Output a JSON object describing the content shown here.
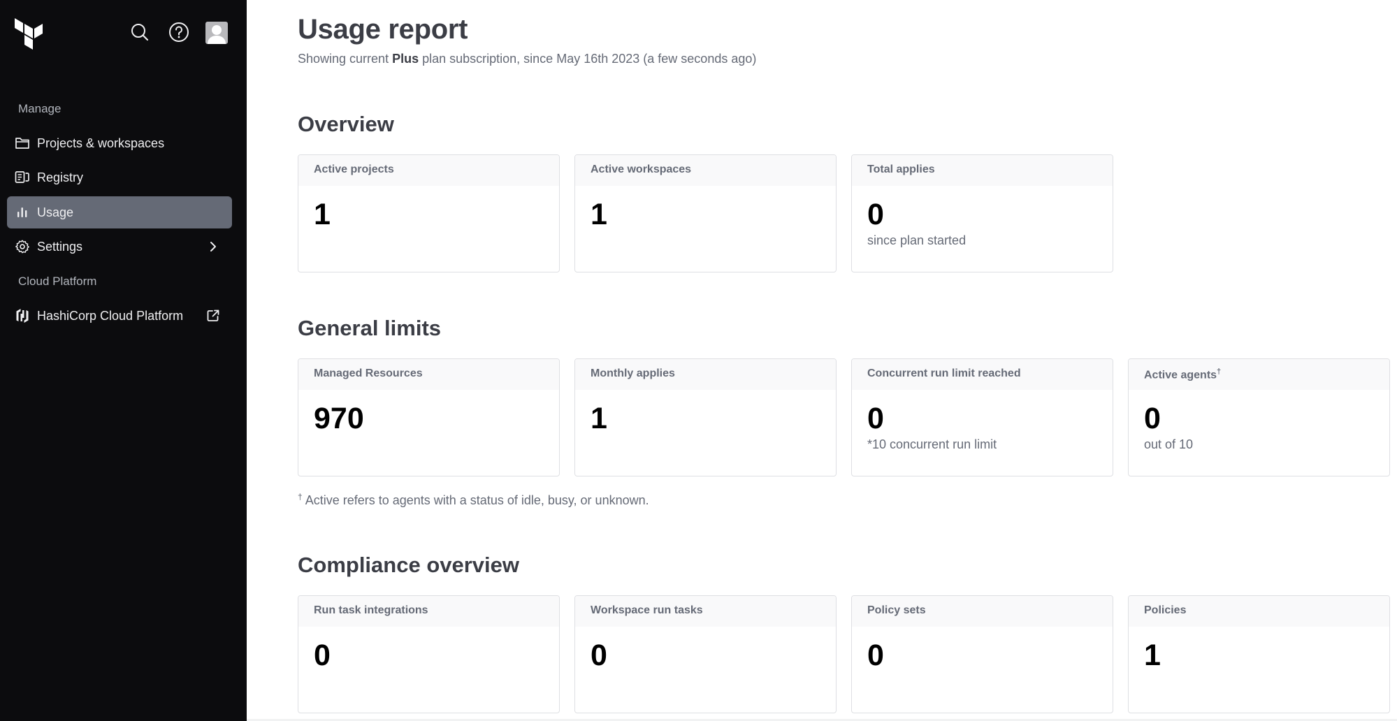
{
  "sidebar": {
    "logo": "terraform-logo",
    "icons": {
      "search": "search-icon",
      "help": "help-icon",
      "avatar": "user-avatar"
    },
    "sections": [
      {
        "label": "Manage"
      },
      {
        "label": "Cloud Platform"
      }
    ],
    "items": [
      {
        "label": "Projects & workspaces",
        "icon": "folder-icon",
        "active": false
      },
      {
        "label": "Registry",
        "icon": "registry-icon",
        "active": false
      },
      {
        "label": "Usage",
        "icon": "bar-chart-icon",
        "active": true
      },
      {
        "label": "Settings",
        "icon": "gear-icon",
        "active": false,
        "trailing": "chevron-right-icon"
      },
      {
        "label": "HashiCorp Cloud Platform",
        "icon": "hashicorp-icon",
        "active": false,
        "trailing": "external-link-icon"
      }
    ],
    "active_color": "#656a76",
    "background_color": "#0c0c0e"
  },
  "header": {
    "title": "Usage report",
    "subtitle_prefix": "Showing current ",
    "plan": "Plus",
    "subtitle_suffix": " plan subscription, since May 16th 2023 (a few seconds ago)"
  },
  "overview": {
    "title": "Overview",
    "cards": [
      {
        "label": "Active projects",
        "value": "1",
        "sub": ""
      },
      {
        "label": "Active workspaces",
        "value": "1",
        "sub": ""
      },
      {
        "label": "Total applies",
        "value": "0",
        "sub": "since plan started"
      }
    ]
  },
  "limits": {
    "title": "General limits",
    "cards": [
      {
        "label": "Managed Resources",
        "value": "970",
        "sub": ""
      },
      {
        "label": "Monthly applies",
        "value": "1",
        "sub": ""
      },
      {
        "label": "Concurrent run limit reached",
        "value": "0",
        "sub": "*10 concurrent run limit"
      },
      {
        "label": "Active agents",
        "label_sup": "†",
        "value": "0",
        "sub": "out of 10"
      }
    ],
    "footnote_mark": "†",
    "footnote": " Active refers to agents with a status of idle, busy, or unknown."
  },
  "compliance": {
    "title": "Compliance overview",
    "cards": [
      {
        "label": "Run task integrations",
        "value": "0",
        "sub": ""
      },
      {
        "label": "Workspace run tasks",
        "value": "0",
        "sub": ""
      },
      {
        "label": "Policy sets",
        "value": "0",
        "sub": ""
      },
      {
        "label": "Policies",
        "value": "1",
        "sub": ""
      }
    ]
  }
}
